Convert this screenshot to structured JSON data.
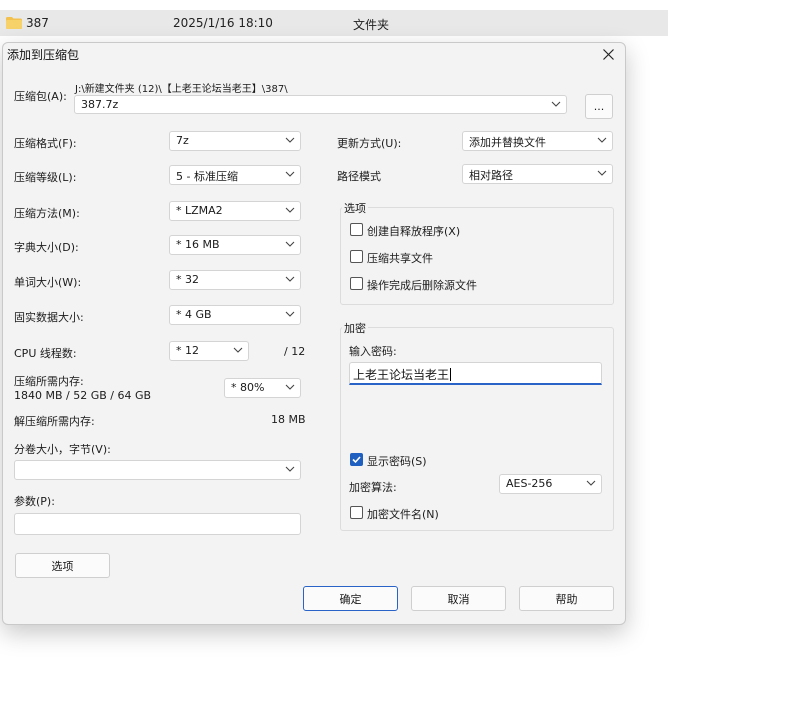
{
  "background_row": {
    "name": "387",
    "date": "2025/1/16 18:10",
    "type": "文件夹"
  },
  "dialog": {
    "title": "添加到压缩包",
    "archive_label": "压缩包(A):",
    "archive_path": "J:\\新建文件夹 (12)\\【上老王论坛当老王】\\387\\",
    "archive_name": "387.7z",
    "browse_label": "...",
    "left": {
      "format_label": "压缩格式(F):",
      "format_value": "7z",
      "level_label": "压缩等级(L):",
      "level_value": "5 - 标准压缩",
      "method_label": "压缩方法(M):",
      "method_value": "*  LZMA2",
      "dict_label": "字典大小(D):",
      "dict_value": "*  16 MB",
      "word_label": "单词大小(W):",
      "word_value": "*  32",
      "solid_label": "固实数据大小:",
      "solid_value": "*  4 GB",
      "threads_label": "CPU 线程数:",
      "threads_value": "*  12",
      "threads_total": "/ 12",
      "mem_label": "压缩所需内存:",
      "mem_detail": "1840 MB / 52 GB / 64 GB",
      "mem_percent": "*  80%",
      "decomp_mem_label": "解压缩所需内存:",
      "decomp_mem_value": "18 MB",
      "volume_label": "分卷大小，字节(V):",
      "volume_value": "",
      "params_label": "参数(P):",
      "params_value": "",
      "options_button": "选项"
    },
    "right": {
      "update_label": "更新方式(U):",
      "update_value": "添加并替换文件",
      "path_label": "路径模式",
      "path_value": "相对路径",
      "options_group": "选项",
      "opt_sfx": "创建自释放程序(X)",
      "opt_shared": "压缩共享文件",
      "opt_delete": "操作完成后删除源文件",
      "encrypt_group": "加密",
      "pwd_label": "输入密码:",
      "pwd_value": "上老王论坛当老王",
      "show_pwd": "显示密码(S)",
      "algo_label": "加密算法:",
      "algo_value": "AES-256",
      "encrypt_names": "加密文件名(N)"
    },
    "buttons": {
      "ok": "确定",
      "cancel": "取消",
      "help": "帮助"
    },
    "checkbox_states": {
      "sfx": false,
      "shared": false,
      "delete": false,
      "show_pwd": true,
      "encrypt_names": false
    },
    "accent_color": "#1f5fbf"
  }
}
